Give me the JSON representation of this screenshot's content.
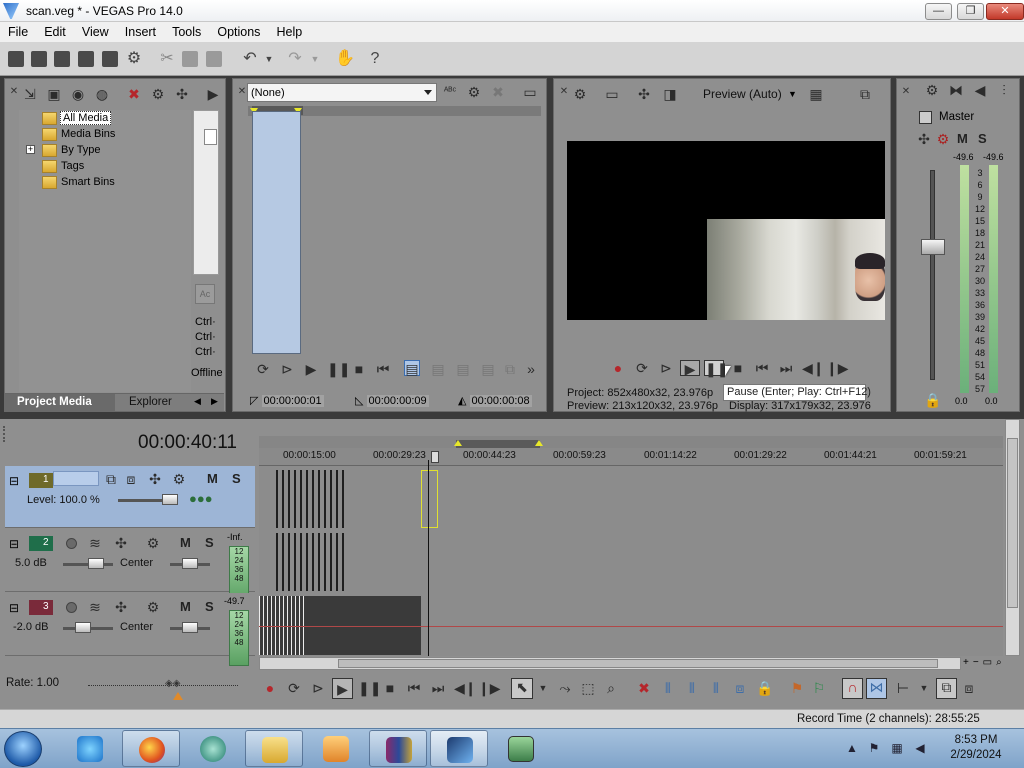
{
  "window": {
    "title": "scan.veg * - VEGAS Pro 14.0",
    "controls": {
      "minimize": "—",
      "maximize": "❐",
      "close": "✕"
    }
  },
  "menu": [
    "File",
    "Edit",
    "View",
    "Insert",
    "Tools",
    "Options",
    "Help"
  ],
  "project_media": {
    "tree": [
      "All Media",
      "Media Bins",
      "By Type",
      "Tags",
      "Smart Bins"
    ],
    "expand_symbol": "+",
    "side_labels": [
      "Ctrl·",
      "Ctrl·",
      "Ctrl·",
      "Offline"
    ],
    "tabs": [
      "Project Media",
      "Explorer"
    ]
  },
  "trimmer": {
    "select_value": "(None)",
    "timecodes": [
      "00:00:00:01",
      "00:00:00:09",
      "00:00:00:08"
    ]
  },
  "preview": {
    "quality": "Preview (Auto)",
    "project_info": "Project:   852x480x32, 23.976p",
    "preview_info": "Preview:  213x120x32, 23.976p",
    "display_info": "Display:    317x179x32, 23.976",
    "tooltip": "Pause (Enter; Play: Ctrl+F12)"
  },
  "mixer": {
    "master_label": "Master",
    "peak_left": "-49.6",
    "peak_right": "-49.6",
    "scale": [
      "3",
      "6",
      "9",
      "12",
      "15",
      "18",
      "21",
      "24",
      "27",
      "30",
      "33",
      "36",
      "39",
      "42",
      "45",
      "48",
      "51",
      "54",
      "57"
    ],
    "bottom_left": "0.0",
    "bottom_right": "0.0",
    "m": "M",
    "s": "S"
  },
  "timeline": {
    "timecode": "00:00:40:11",
    "ruler": [
      "00:00:15:00",
      "00:00:29:23",
      "00:00:44:23",
      "00:00:59:23",
      "00:01:14:22",
      "00:01:29:22",
      "00:01:44:21",
      "00:01:59:21"
    ],
    "tracks": [
      {
        "num": "1",
        "level": "Level: 100.0 %"
      },
      {
        "num": "2",
        "db": "5.0 dB",
        "pan": "Center",
        "peak": "-Inf.",
        "meter": [
          "12",
          "24",
          "36",
          "48"
        ]
      },
      {
        "num": "3",
        "db": "-2.0 dB",
        "pan": "Center",
        "peak": "-49.7",
        "meter": [
          "12",
          "24",
          "36",
          "48"
        ]
      }
    ],
    "m": "M",
    "s": "S",
    "rate": "Rate: 1.00"
  },
  "status": {
    "record_time": "Record Time (2 channels): 28:55:25"
  },
  "taskbar": {
    "time": "8:53 PM",
    "date": "2/29/2024"
  },
  "colors": {
    "selected_track": "#9db5d6",
    "panel": "#8f8f8f",
    "meter_green": "#6bb07a",
    "cursor_yellow": "#e8e82a"
  }
}
